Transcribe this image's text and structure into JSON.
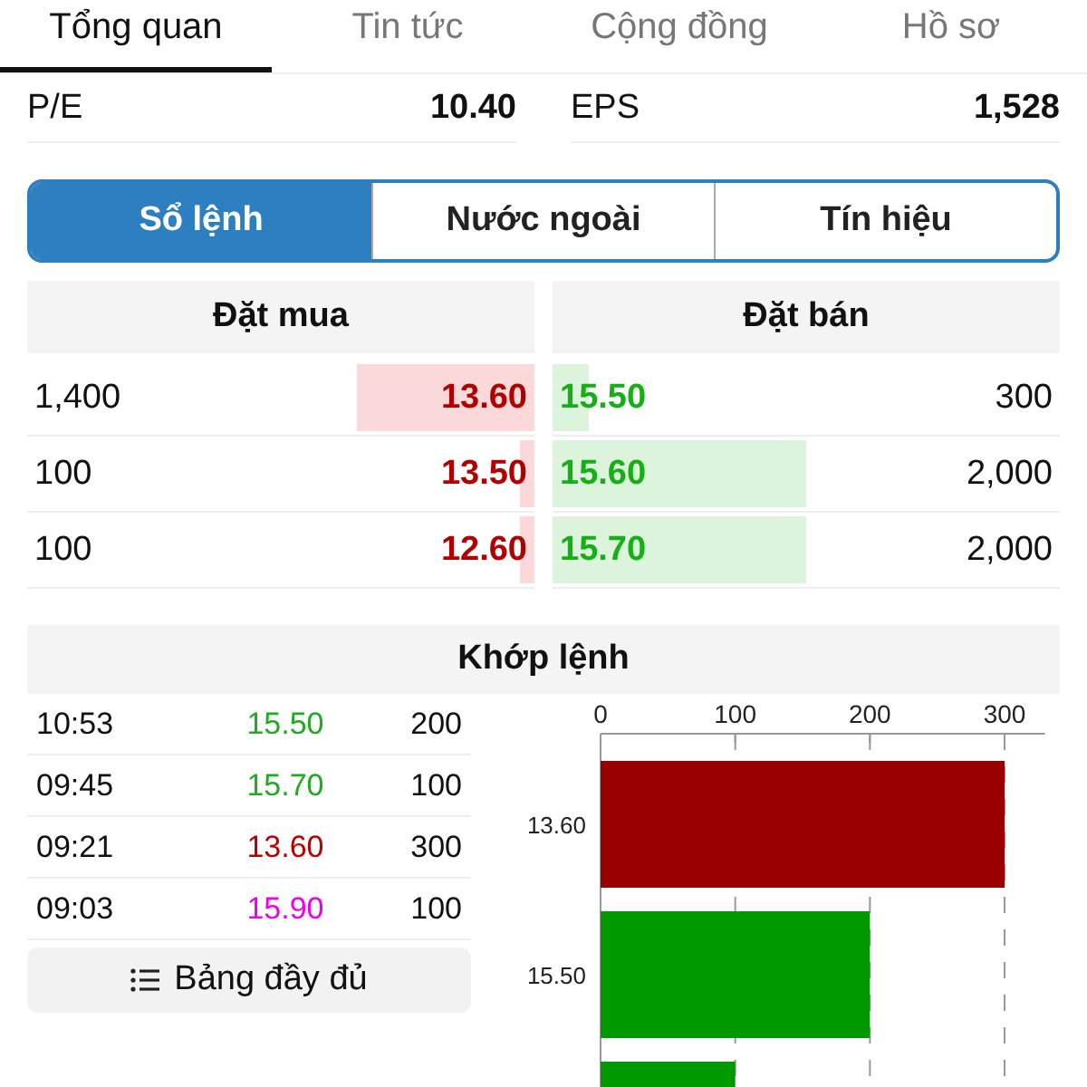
{
  "tabs": [
    {
      "label": "Tổng quan",
      "selected": true
    },
    {
      "label": "Tin tức",
      "selected": false
    },
    {
      "label": "Cộng đồng",
      "selected": false
    },
    {
      "label": "Hồ sơ",
      "selected": false
    }
  ],
  "stats": [
    {
      "label": "P/E",
      "value": "10.40"
    },
    {
      "label": "EPS",
      "value": "1,528"
    }
  ],
  "segments": [
    {
      "label": "Sổ lệnh",
      "selected": true
    },
    {
      "label": "Nước ngoài",
      "selected": false
    },
    {
      "label": "Tín hiệu",
      "selected": false
    }
  ],
  "order_book": {
    "bid_title": "Đặt mua",
    "ask_title": "Đặt bán",
    "rows": [
      {
        "bid": {
          "volume": "1,400",
          "price": "13.60",
          "level": 0.35
        },
        "ask": {
          "price": "15.50",
          "level": 0.07,
          "volume": "300"
        }
      },
      {
        "bid": {
          "volume": "100",
          "price": "13.50",
          "level": 0.03
        },
        "ask": {
          "price": "15.60",
          "level": 0.5,
          "volume": "2,000"
        }
      },
      {
        "bid": {
          "volume": "100",
          "price": "12.60",
          "level": 0.03
        },
        "ask": {
          "price": "15.70",
          "level": 0.5,
          "volume": "2,000"
        }
      }
    ]
  },
  "matched": {
    "title": "Khớp lệnh",
    "trades": [
      {
        "time": "10:53",
        "price": "15.50",
        "color": "#22aa22",
        "volume": "200"
      },
      {
        "time": "09:45",
        "price": "15.70",
        "color": "#22aa22",
        "volume": "100"
      },
      {
        "time": "09:21",
        "price": "13.60",
        "color": "#bb0000",
        "volume": "300"
      },
      {
        "time": "09:03",
        "price": "15.90",
        "color": "#ee00ee",
        "volume": "100"
      }
    ],
    "full_table_button": "Bảng đầy đủ",
    "chart_data": {
      "type": "bar",
      "orientation": "horizontal",
      "stacked": true,
      "grid": true,
      "categories": [
        "13.60",
        "15.50",
        null
      ],
      "xlim": [
        0,
        330
      ],
      "xticks": [
        0,
        100,
        200,
        300
      ],
      "series": [
        {
          "color": "#990000",
          "values": [
            300,
            null,
            null
          ]
        },
        {
          "color": "#009900",
          "values": [
            null,
            200,
            100
          ]
        }
      ]
    }
  }
}
